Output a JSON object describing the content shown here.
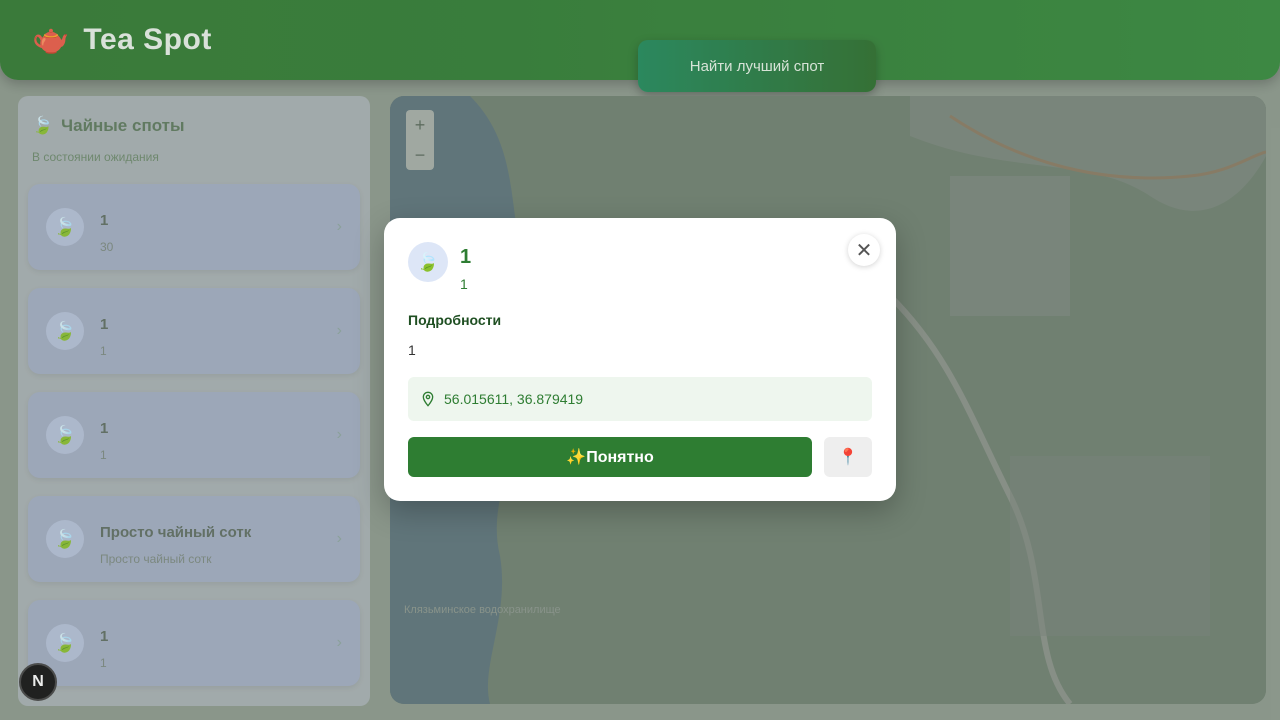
{
  "header": {
    "logo_icon": "🫖",
    "title": "Tea Spot",
    "find_button": "Найти лучший спот"
  },
  "sidebar": {
    "icon": "🍃",
    "title": "Чайные споты",
    "subtitle": "В состоянии ожидания",
    "items": [
      {
        "icon": "🍃",
        "title": "1",
        "subtitle": "30"
      },
      {
        "icon": "🍃",
        "title": "1",
        "subtitle": "1"
      },
      {
        "icon": "🍃",
        "title": "1",
        "subtitle": "1"
      },
      {
        "icon": "🍃",
        "title": "Просто чайный сотк",
        "subtitle": "Просто чайный сотк"
      },
      {
        "icon": "🍃",
        "title": "1",
        "subtitle": "1"
      }
    ]
  },
  "map": {
    "zoom_in": "+",
    "zoom_out": "−",
    "label": "Клязьминское водохранилище"
  },
  "next_badge": "N",
  "modal": {
    "icon": "🍃",
    "title": "1",
    "subtitle": "1",
    "details_title": "Подробности",
    "details_text": "1",
    "coordinates": "56.015611, 36.879419",
    "ok_button": "✨Понятно",
    "pin_icon": "📍",
    "close_icon": "✕",
    "accent_color": "#2e7d32"
  }
}
